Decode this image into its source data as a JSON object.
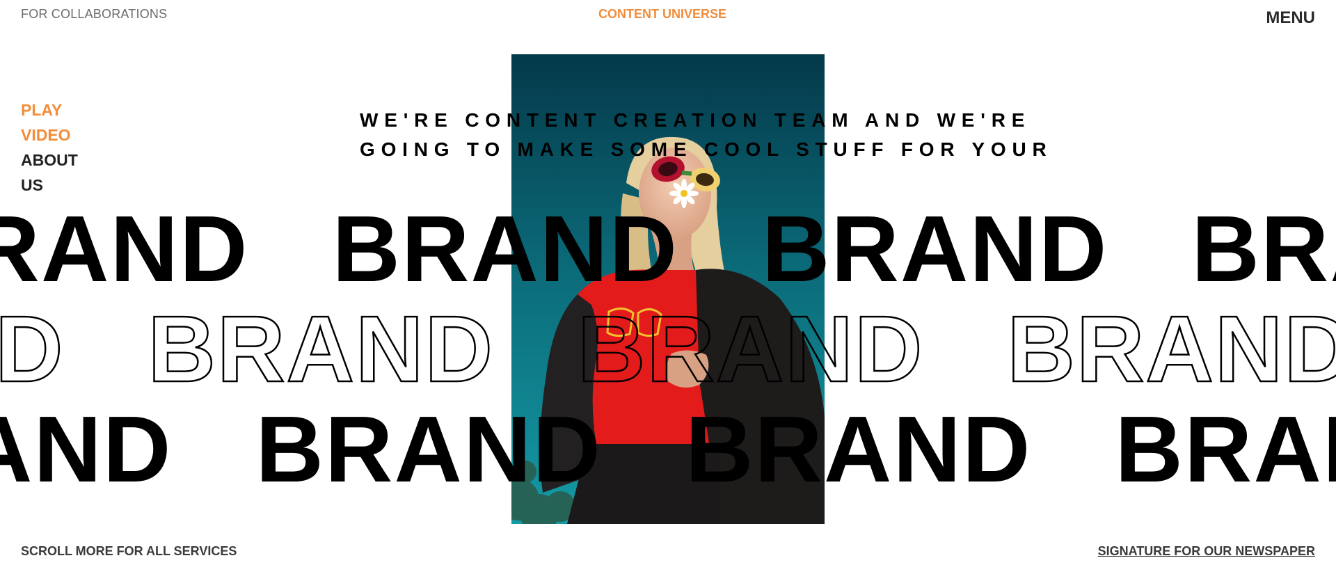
{
  "header": {
    "left_link": "FOR COLLABORATIONS",
    "title": "CONTENT UNIVERSE",
    "menu_label": "MENU"
  },
  "side_nav": {
    "play_line1": "PLAY",
    "play_line2": "VIDEO",
    "about_line1": "ABOUT",
    "about_line2": "US"
  },
  "headline": {
    "line1": "WE'RE CONTENT CREATION TEAM AND WE'RE",
    "line2": "GOING TO MAKE SOME COOL STUFF FOR YOUR"
  },
  "marquee": {
    "word": "BRAND"
  },
  "footer": {
    "scroll_hint": "SCROLL MORE FOR ALL SERVICES",
    "newsletter_link": "SIGNATURE FOR OUR NEWSPAPER"
  },
  "colors": {
    "accent": "#f28c3a",
    "text": "#000000",
    "photo_background": "#0a6875",
    "shirt": "#e31b1b"
  }
}
